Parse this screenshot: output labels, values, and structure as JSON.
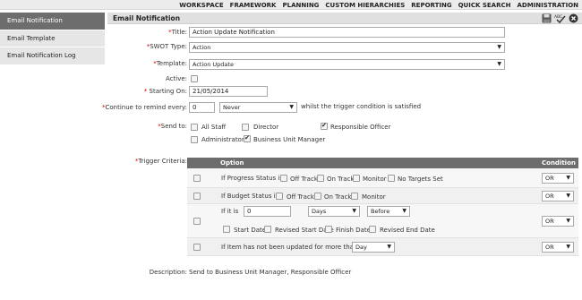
{
  "topnav": {
    "items": [
      "WORKSPACE",
      "FRAMEWORK",
      "PLANNING",
      "CUSTOM HIERARCHIES",
      "REPORTING",
      "QUICK SEARCH",
      "ADMINISTRATION"
    ]
  },
  "sidebar": {
    "items": [
      {
        "label": "Email Notification",
        "active": true
      },
      {
        "label": "Email Template",
        "active": false
      },
      {
        "label": "Email Notification Log",
        "active": false
      }
    ]
  },
  "panel": {
    "title": "Email Notification",
    "tools": {
      "save": "save-icon",
      "spellcheck": "spellcheck-icon",
      "close": "close-icon"
    }
  },
  "form": {
    "title_label": "Title:",
    "title_value": "Action Update Notification",
    "swot_label": "SWOT Type:",
    "swot_value": "Action",
    "template_label": "Template:",
    "template_value": "Action Update",
    "active_label": "Active:",
    "starting_label": "Starting On:",
    "starting_value": "21/05/2014",
    "remind_label": "Continue to remind every:",
    "remind_value": "0",
    "remind_unit": "Never",
    "remind_suffix": "whilst the trigger condition is satisfied",
    "sendto_label": "Send to:",
    "sendto_options": [
      {
        "label": "All Staff",
        "checked": false
      },
      {
        "label": "Director",
        "checked": false
      },
      {
        "label": "Responsible Officer",
        "checked": true
      },
      {
        "label": "Administrator",
        "checked": false
      },
      {
        "label": "Business Unit Manager",
        "checked": true
      }
    ],
    "trigger_label": "Trigger Criteria:",
    "description_label": "Description:",
    "description_value": "Send to Business Unit Manager, Responsible Officer"
  },
  "grid": {
    "col_option": "Option",
    "col_condition": "Condition",
    "rows": [
      {
        "prefix": "If Progress Status is",
        "options": [
          "Off Track",
          "On Track",
          "Monitor",
          "No Targets Set"
        ],
        "condition": "OR"
      },
      {
        "prefix": "If Budget Status is",
        "options": [
          "Off Track",
          "On Track",
          "Monitor"
        ],
        "condition": "OR"
      },
      {
        "prefix": "If it is",
        "value": "0",
        "unit": "Days",
        "relation": "Before",
        "options": [
          "Start Date",
          "Revised Start Date",
          "Finish Date",
          "Revised End Date"
        ],
        "condition": "OR"
      },
      {
        "prefix": "If Item has not been updated for more than a",
        "period": "Day",
        "condition": "OR"
      }
    ]
  },
  "colors": {
    "active_tab": "#6d6d6d",
    "header_bg": "#e0e0e0",
    "required": "#dd0000"
  }
}
